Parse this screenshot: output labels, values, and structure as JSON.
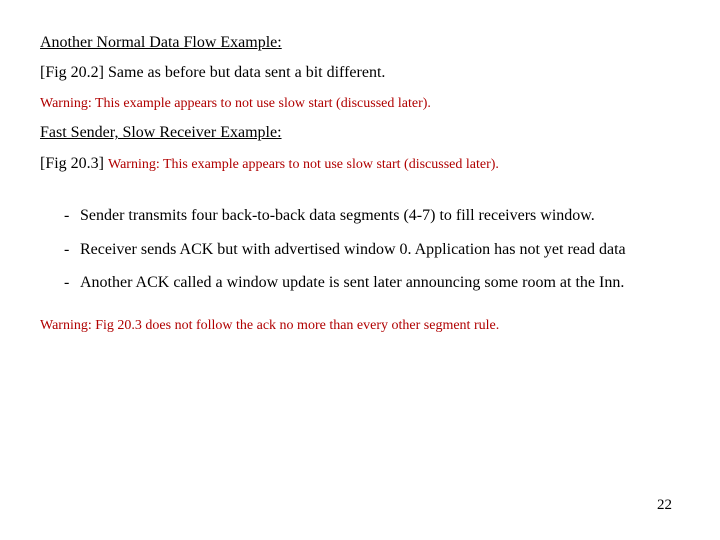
{
  "heading1": "Another Normal Data Flow Example:",
  "fig202": "[Fig 20.2] Same as before but data sent a bit different.",
  "warn1": "Warning: This example appears to not use slow start (discussed later).",
  "heading2": "Fast Sender, Slow Receiver Example:",
  "fig203_prefix": "[Fig 20.3] ",
  "fig203_warn": "Warning: This example appears to not use slow start (discussed later).",
  "bullets": [
    "Sender transmits four back-to-back data segments (4-7) to fill receivers window.",
    "Receiver sends ACK but with advertised window 0. Application has not yet read data",
    "Another ACK called a window update is sent later announcing some room at the Inn."
  ],
  "footer_warn": "Warning: Fig 20.3 does not follow the ack no more than every other segment rule.",
  "page_number": "22"
}
